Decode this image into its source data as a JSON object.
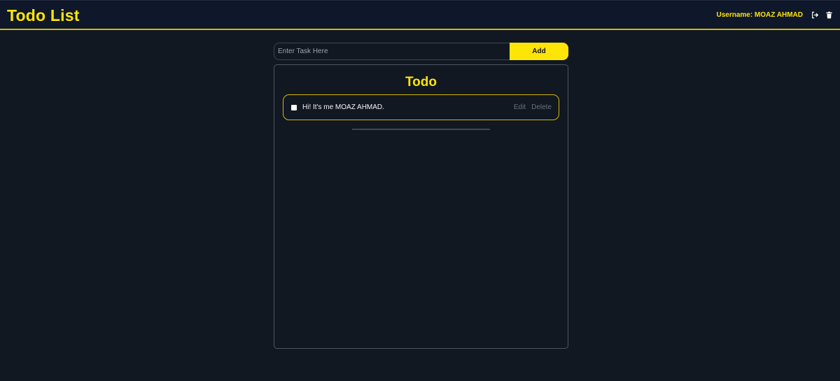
{
  "app": {
    "title": "Todo List",
    "username_label": "Username: MOAZ AHMAD",
    "logout_icon": "sign-out-icon",
    "delete_account_icon": "trash-icon",
    "accent_color": "#fde507",
    "background_color": "#111821"
  },
  "add_task": {
    "placeholder": "Enter Task Here",
    "value": "",
    "button_label": "Add"
  },
  "todo_panel": {
    "title": "Todo",
    "items": [
      {
        "text": "Hi! It's me MOAZ AHMAD.",
        "checked": false,
        "edit_label": "Edit",
        "delete_label": "Delete"
      }
    ]
  }
}
